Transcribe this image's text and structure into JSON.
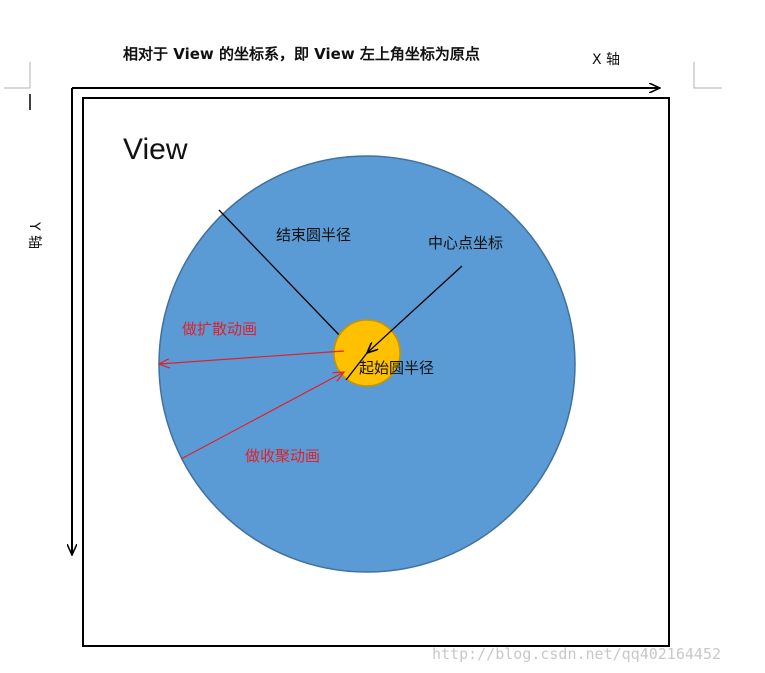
{
  "title": "相对于 View 的坐标系，即 View 左上角坐标为原点",
  "x_axis_label": "X 轴",
  "y_axis_label": "Y 轴",
  "view_label": "View",
  "labels": {
    "end_radius": "结束圆半径",
    "center_point": "中心点坐标",
    "start_radius": "起始圆半径",
    "expand_animation": "做扩散动画",
    "shrink_animation": "做收聚动画"
  },
  "watermark": "http://blog.csdn.net/qq402164452",
  "colors": {
    "big_circle": "#5b9bd5",
    "big_circle_stroke": "#41719c",
    "small_circle": "#ffc000",
    "small_circle_stroke": "#c79400",
    "animation_arrow": "#e0202a",
    "line": "#000000"
  }
}
